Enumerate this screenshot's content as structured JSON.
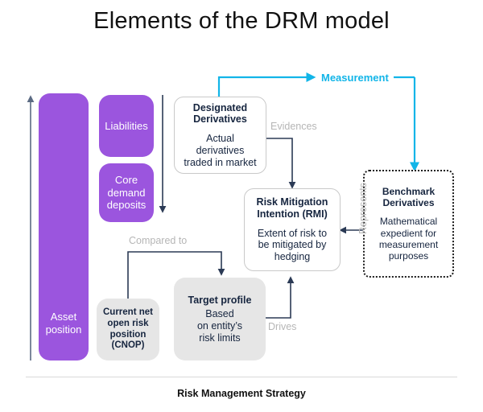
{
  "header": {
    "title": "Elements of the DRM model"
  },
  "footer": {
    "label": "Risk Management Strategy"
  },
  "colors": {
    "purple": "#9b55de",
    "cyan_accent": "#12b5e8",
    "navy_text": "#16253f",
    "grey_box": "#e6e6e6",
    "connector_label": "#b6b6b6",
    "connector_line": "#2b3a55"
  },
  "balance_sheet": {
    "asset_column": {
      "label": "Asset position"
    },
    "liability_blocks": [
      {
        "label": "Liabilities"
      },
      {
        "label": "Core\ndemand\ndeposits"
      }
    ]
  },
  "boxes": {
    "designated_derivatives": {
      "title": "Designated\nDerivatives",
      "body": "Actual\nderivatives\ntraded in market"
    },
    "risk_mitigation_intention": {
      "title": "Risk Mitigation\nIntention (RMI)",
      "title_plain": "Risk Mitigation Intention (",
      "title_bold": "RMI",
      "title_tail": ")",
      "body": "Extent of risk to\nbe mitigated by\nhedging"
    },
    "benchmark_derivatives": {
      "title": "Benchmark\nDerivatives",
      "body": "Mathematical\nexpedient for\nmeasurement\npurposes"
    },
    "current_net_open_risk_position": {
      "text": "Current net\nopen risk\nposition\n(CNOP)"
    },
    "target_profile": {
      "title": "Target profile",
      "body": "Based\non entity’s\nrisk limits"
    }
  },
  "connectors": {
    "measurement": "Measurement",
    "evidences": "Evidences",
    "represents": "Represents",
    "compared_to": "Compared to",
    "drives": "Drives"
  }
}
